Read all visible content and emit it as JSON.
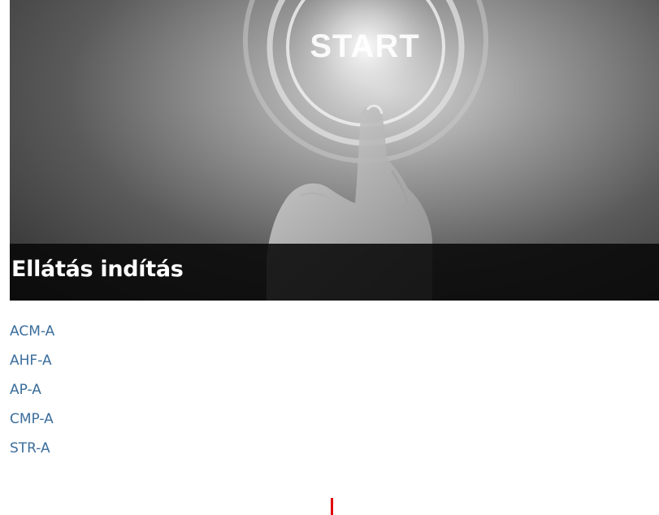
{
  "card": {
    "image": {
      "button_text": "START",
      "description_icon": "hand-pressing-start-button"
    },
    "title": "Ellátás indítás",
    "links": [
      {
        "label": "ACM-A"
      },
      {
        "label": "AHF-A"
      },
      {
        "label": "AP-A"
      },
      {
        "label": "CMP-A"
      },
      {
        "label": "STR-A"
      }
    ]
  },
  "colors": {
    "link": "#3b6e9c",
    "caption_bg": "#080808",
    "caption_text": "#ffffff",
    "cursor": "#e00000"
  }
}
